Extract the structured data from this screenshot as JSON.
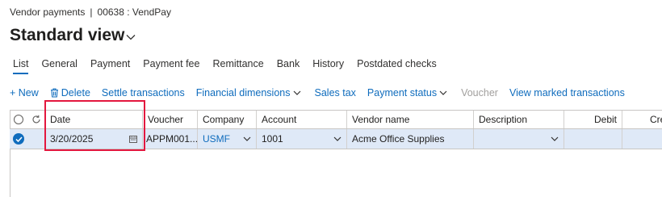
{
  "breadcrumb": {
    "section": "Vendor payments",
    "separator": "|",
    "journal": "00638 : VendPay"
  },
  "title": "Standard view",
  "tabs": [
    "List",
    "General",
    "Payment",
    "Payment fee",
    "Remittance",
    "Bank",
    "History",
    "Postdated checks"
  ],
  "toolbar": {
    "new": "+ New",
    "delete": "Delete",
    "settle": "Settle transactions",
    "financial_dimensions": "Financial dimensions",
    "sales_tax": "Sales tax",
    "payment_status": "Payment status",
    "voucher": "Voucher",
    "view_marked": "View marked transactions"
  },
  "grid": {
    "headers": {
      "date": "Date",
      "voucher": "Voucher",
      "company": "Company",
      "account": "Account",
      "vendor_name": "Vendor name",
      "description": "Description",
      "debit": "Debit",
      "credit": "Cre"
    },
    "row": {
      "date": "3/20/2025",
      "voucher": "APPM001...",
      "company": "USMF",
      "account": "1001",
      "vendor_name": "Acme Office Supplies",
      "description": "",
      "debit": "",
      "credit": ""
    }
  },
  "colors": {
    "accent": "#0f6cbd",
    "selected_row": "#dfe9f7",
    "highlight": "#e3173e"
  }
}
